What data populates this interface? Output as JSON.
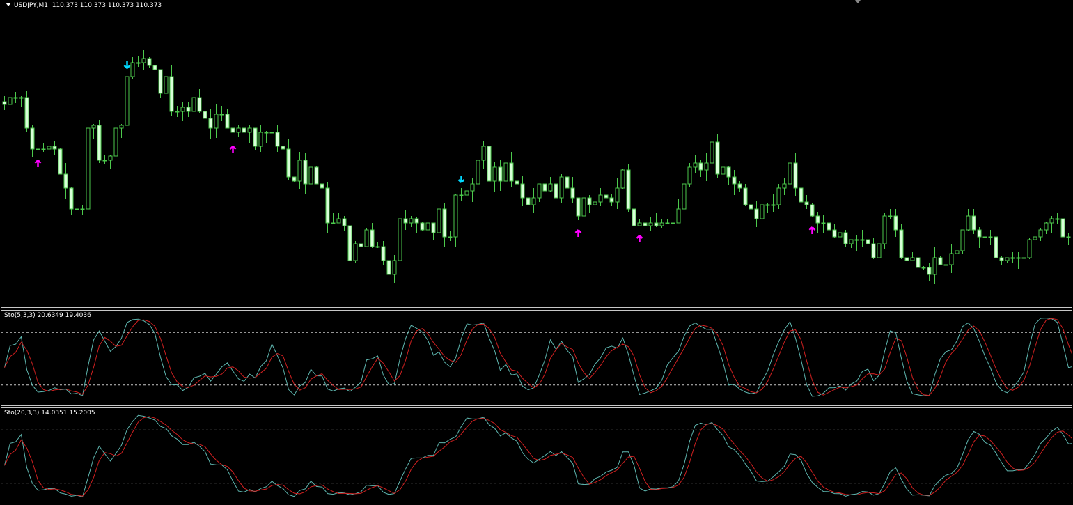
{
  "header": {
    "symbol_timeframe": "USDJPY,M1",
    "ohlc": "110.373 110.373 110.373 110.373"
  },
  "indicators": [
    {
      "name": "Sto(5,3,3)",
      "main": "20.6349",
      "signal": "19.4036",
      "k": 5,
      "d": 3,
      "slowing": 3,
      "levels": [
        20,
        80
      ]
    },
    {
      "name": "Sto(20,3,3)",
      "main": "14.0351",
      "signal": "15.2005",
      "k": 20,
      "d": 3,
      "slowing": 3,
      "levels": [
        20,
        80
      ]
    }
  ],
  "colors": {
    "bull_outline": "#4cc94c",
    "bear_fill": "#d8ffd8",
    "main_line": "#5fb7b0",
    "signal_line": "#d02020",
    "up_arrow": "#ff00ff",
    "down_arrow": "#00d8ff"
  },
  "chart_data": {
    "type": "candlestick",
    "price_base": 110.0,
    "closes_points": [
      453,
      458,
      458,
      458,
      436,
      421,
      421,
      421,
      423,
      421,
      403,
      393,
      378,
      378,
      378,
      436,
      438,
      413,
      413,
      416,
      436,
      438,
      473,
      483,
      483,
      486,
      481,
      478,
      461,
      473,
      448,
      448,
      451,
      448,
      458,
      448,
      443,
      436,
      446,
      446,
      436,
      433,
      436,
      433,
      436,
      423,
      433,
      433,
      433,
      423,
      421,
      401,
      398,
      413,
      396,
      408,
      396,
      393,
      368,
      368,
      371,
      366,
      341,
      353,
      351,
      363,
      351,
      351,
      341,
      331,
      341,
      371,
      368,
      371,
      368,
      363,
      368,
      361,
      378,
      358,
      358,
      388,
      388,
      391,
      396,
      413,
      423,
      398,
      408,
      398,
      411,
      398,
      396,
      386,
      381,
      386,
      396,
      391,
      396,
      386,
      401,
      393,
      386,
      373,
      386,
      381,
      383,
      388,
      386,
      383,
      393,
      406,
      378,
      366,
      368,
      366,
      368,
      366,
      368,
      368,
      368,
      378,
      396,
      408,
      411,
      406,
      411,
      426,
      403,
      408,
      401,
      396,
      393,
      381,
      378,
      371,
      381,
      381,
      381,
      393,
      396,
      411,
      393,
      383,
      381,
      373,
      368,
      368,
      363,
      358,
      361,
      353,
      356,
      356,
      356,
      353,
      343,
      353,
      373,
      373,
      363,
      343,
      341,
      343,
      336,
      336,
      331,
      343,
      338,
      338,
      346,
      348,
      363,
      373,
      363,
      358,
      358,
      358,
      343,
      341,
      343,
      343,
      343,
      343,
      356,
      358,
      363,
      368,
      371,
      371,
      358,
      358,
      373
    ],
    "signals": [
      {
        "type": "buy",
        "index": 6
      },
      {
        "type": "buy",
        "index": 41
      },
      {
        "type": "buy",
        "index": 103
      },
      {
        "type": "buy",
        "index": 114
      },
      {
        "type": "buy",
        "index": 145
      },
      {
        "type": "sell",
        "index": 22
      },
      {
        "type": "sell",
        "index": 82
      }
    ]
  }
}
